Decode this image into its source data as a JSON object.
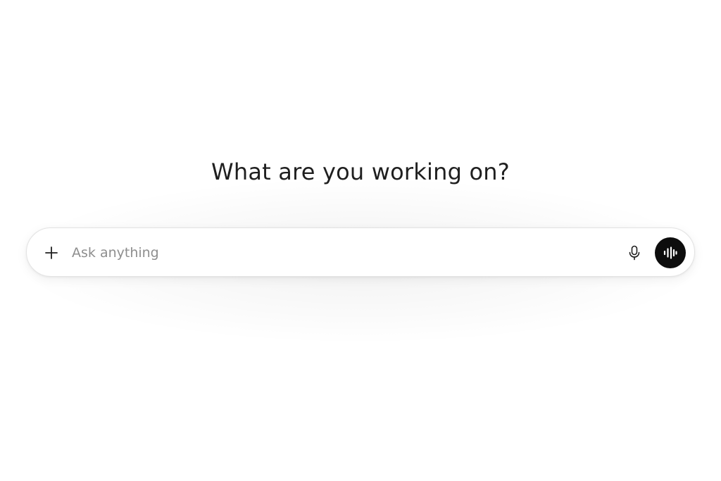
{
  "main": {
    "heading": "What are you working on?"
  },
  "composer": {
    "placeholder": "Ask anything",
    "value": "",
    "icons": {
      "attach": "plus-icon",
      "dictate": "microphone-icon",
      "voice": "voice-waveform-icon"
    }
  },
  "colors": {
    "background": "#ffffff",
    "heading_text": "#1f1f1f",
    "placeholder_text": "#8e8e8e",
    "composer_border": "#e3e3e3",
    "voice_button": "#0d0d0d"
  }
}
